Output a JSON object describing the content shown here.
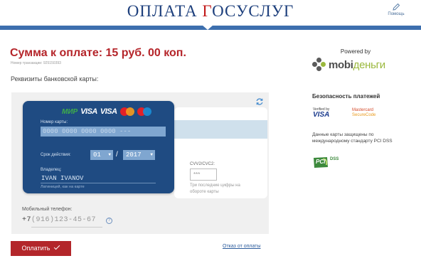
{
  "header": {
    "logo_prefix": "ОПЛАТА ",
    "logo_g": "Г",
    "logo_suffix": "ОСУСЛУГ",
    "help_label": "Помощь"
  },
  "payment": {
    "amount_title": "Сумма к оплате:  15 руб. 00 коп.",
    "transaction_number": "Номер транзакции: 925150393",
    "requisites_label": "Реквизиты банковской карты:"
  },
  "card": {
    "brand_mir": "МИР",
    "brand_visa": "VISA",
    "brand_visa_electron": "VISA",
    "number_label": "Номер карты:",
    "number_placeholder": "0000 0000 0000 0000 ---",
    "expiry_label": "Срок действия:",
    "expiry_month": "01",
    "expiry_year": "2017",
    "expiry_separator": "/",
    "owner_label": "Владелец:",
    "owner_value": "IVAN IVANOV",
    "owner_hint": "Латиницей, как на карте",
    "cvv_label": "CVV2/CVC2:",
    "cvv_placeholder": "***",
    "cvv_hint": "Три последние цифры на обороте карты"
  },
  "phone": {
    "label": "Мобильный телефон:",
    "prefix": "+7",
    "placeholder": "(916)123-45-67",
    "info_symbol": "?"
  },
  "actions": {
    "pay_label": "Оплатить",
    "decline_label": "Отказ от оплаты"
  },
  "sidebar": {
    "powered_by": "Powered by",
    "mobi_brand": "mobi",
    "mobi_brand_accent": "деньги",
    "security_title": "Безопасность платежей",
    "vbv_small": "Verified by",
    "vbv_visa": "VISA",
    "mc_line1": "Mastercard",
    "mc_line2": "SecureCode",
    "security_text": "Данные карты защищены по международному стандарту PCI DSS",
    "pci_label": "PCI",
    "pci_dss": "DSS"
  },
  "colors": {
    "brand_red": "#b3262a",
    "brand_blue": "#3d6fae",
    "card_blue": "#1f4b82",
    "mobi_green": "#9ab83c"
  },
  "icons": {
    "help": "pencil-icon",
    "refresh": "refresh-icon",
    "info": "info-icon",
    "check": "check-icon"
  }
}
